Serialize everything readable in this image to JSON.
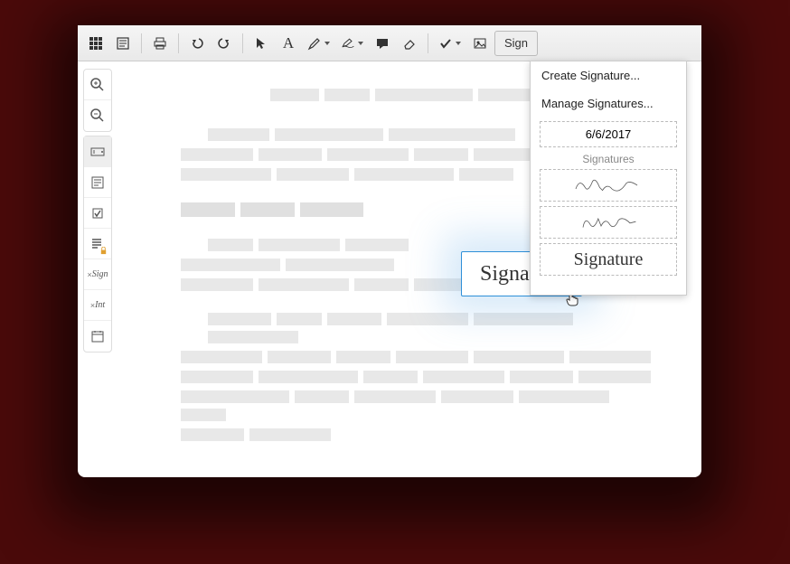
{
  "toolbar": {
    "sign_label": "Sign"
  },
  "dropdown": {
    "create": "Create Signature...",
    "manage": "Manage Signatures...",
    "date": "6/6/2017",
    "section_label": "Signatures",
    "sig3": "Signature"
  },
  "placed_signature": {
    "text": "Signature"
  },
  "sidebar": {
    "sign_label": "Sign",
    "int_label": "Int"
  }
}
